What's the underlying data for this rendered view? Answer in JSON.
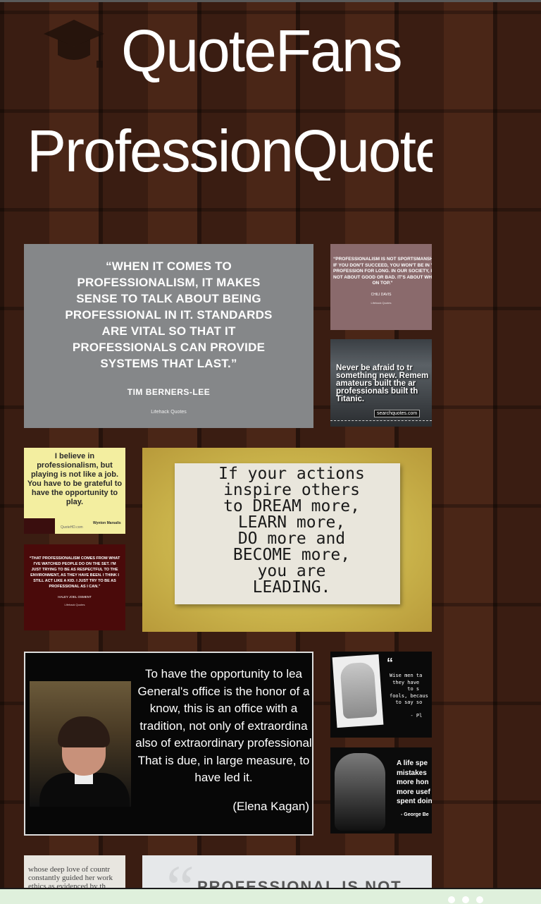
{
  "app": {
    "brand": "QuoteFans",
    "title": "ProfessionQuotes"
  },
  "tiles": [
    {
      "quote": "“WHEN IT COMES TO PROFESSIONALISM, IT MAKES SENSE TO TALK ABOUT BEING PROFESSIONAL IN IT. STANDARDS ARE VITAL SO THAT IT PROFESSIONALS CAN PROVIDE SYSTEMS THAT LAST.”",
      "author": "TIM BERNERS-LEE",
      "source": "Lifehack Quotes"
    },
    {
      "quote": "“PROFESSIONALISM IS NOT SPORTSMANSH\nIF YOU DON'T SUCCEED, YOU WON'T BE IN YO\nPROFESSION FOR LONG. IN OUR SOCIETY, IT\nNOT ABOUT GOOD OR BAD. IT'S ABOUT WHO\nON TOP.”",
      "author": "CHILI DAVIS",
      "source": "Lifehack Quotes"
    },
    {
      "quote": "Never be afraid to tr\nsomething new. Remem\namateurs built the ar\nprofessionals built th\nTitanic.",
      "source": "searchquotes.com"
    },
    {
      "quote": "I believe in professionalism, but playing is not like a job. You have to be grateful to have the opportunity to play.",
      "author": "Wynton Marsalis",
      "source": "QuoteHD.com"
    },
    {
      "quote": "“THAT PROFESSIONALISM COMES FROM WHAT I'VE WATCHED PEOPLE DO ON THE SET. I'M JUST TRYING TO BE AS RESPECTFUL TO THE ENVIRONMENT, AS THEY HAVE BEEN. I THINK I STILL ACT LIKE A KID. I JUST TRY TO BE AS PROFESSIONAL AS I CAN.”",
      "author": "HALEY JOEL OSMENT",
      "source": "Lifehack Quotes"
    },
    {
      "quote": "If your actions\ninspire others\nto DREAM more,\nLEARN more,\nDO more and\nBECOME more,\nyou are\nLEADING."
    },
    {
      "quote": "To have the opportunity to lea\nGeneral's office is the honor of a\nknow, this is an office with a\ntradition, not only of extraordina\nalso of extraordinary professional\nThat is due, in large measure, to\nhave led it.",
      "author": "(Elena Kagan)"
    },
    {
      "mark": "“",
      "quote": "Wise men ta\n they have \n      to s\nfools, becaus\n  to say so\n\n       - Pl"
    },
    {
      "quote": "A life spe\nmistakes\nmore hon\nmore usef\nspent doin",
      "author": "- George Be"
    },
    {
      "quote": "whose deep love of countr\nconstantly guided her work\nethics as evidenced by th"
    },
    {
      "mark": "“",
      "quote": "PROFESSIONAL IS NOT"
    }
  ]
}
